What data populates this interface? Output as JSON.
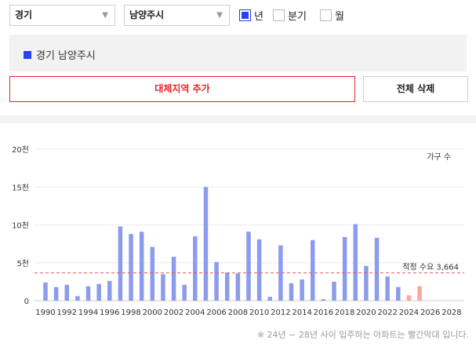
{
  "filters": {
    "region": "경기",
    "district": "남양주시",
    "caret": "▼",
    "period_options": [
      {
        "label": "년",
        "checked": true
      },
      {
        "label": "분기",
        "checked": false
      },
      {
        "label": "월",
        "checked": false
      }
    ]
  },
  "selected_regions": [
    "경기 남양주시"
  ],
  "buttons": {
    "add_region": "대체지역 추가",
    "delete_all": "전체 삭제"
  },
  "chart_data": {
    "type": "bar",
    "legend_label": "가구 수",
    "y_tick_labels": [
      "0",
      "5천",
      "10천",
      "15천",
      "20천"
    ],
    "ylim": [
      0,
      20000
    ],
    "x": [
      1990,
      1991,
      1992,
      1993,
      1994,
      1995,
      1996,
      1997,
      1998,
      1999,
      2000,
      2001,
      2002,
      2003,
      2004,
      2005,
      2006,
      2007,
      2008,
      2009,
      2010,
      2011,
      2012,
      2013,
      2014,
      2015,
      2016,
      2017,
      2018,
      2019,
      2020,
      2021,
      2022,
      2023,
      2024,
      2025,
      2026,
      2027,
      2028
    ],
    "x_tick_labels": [
      "1990",
      "1992",
      "1994",
      "1996",
      "1998",
      "2000",
      "2002",
      "2004",
      "2006",
      "2008",
      "2010",
      "2012",
      "2014",
      "2016",
      "2018",
      "2020",
      "2022",
      "2024",
      "2026",
      "2028"
    ],
    "values": [
      2400,
      1800,
      2100,
      600,
      1900,
      2200,
      2600,
      9800,
      8800,
      9100,
      7100,
      3500,
      5800,
      2100,
      8500,
      15000,
      5100,
      3700,
      3600,
      9100,
      8100,
      500,
      7300,
      2300,
      2800,
      8000,
      200,
      2500,
      8400,
      10100,
      4600,
      8300,
      3200,
      1800,
      700,
      1900,
      0,
      0,
      0
    ],
    "colors": {
      "actual": "#8c9cec",
      "planned": "#f6a89a",
      "threshold": "#e05a5a",
      "grid": "#ececec"
    },
    "threshold": {
      "value": 3664,
      "label": "적정 수요 3,664"
    }
  },
  "note": "※ 24년 ~ 28년 사이 입주하는 아파트는 빨간막대 입니다."
}
